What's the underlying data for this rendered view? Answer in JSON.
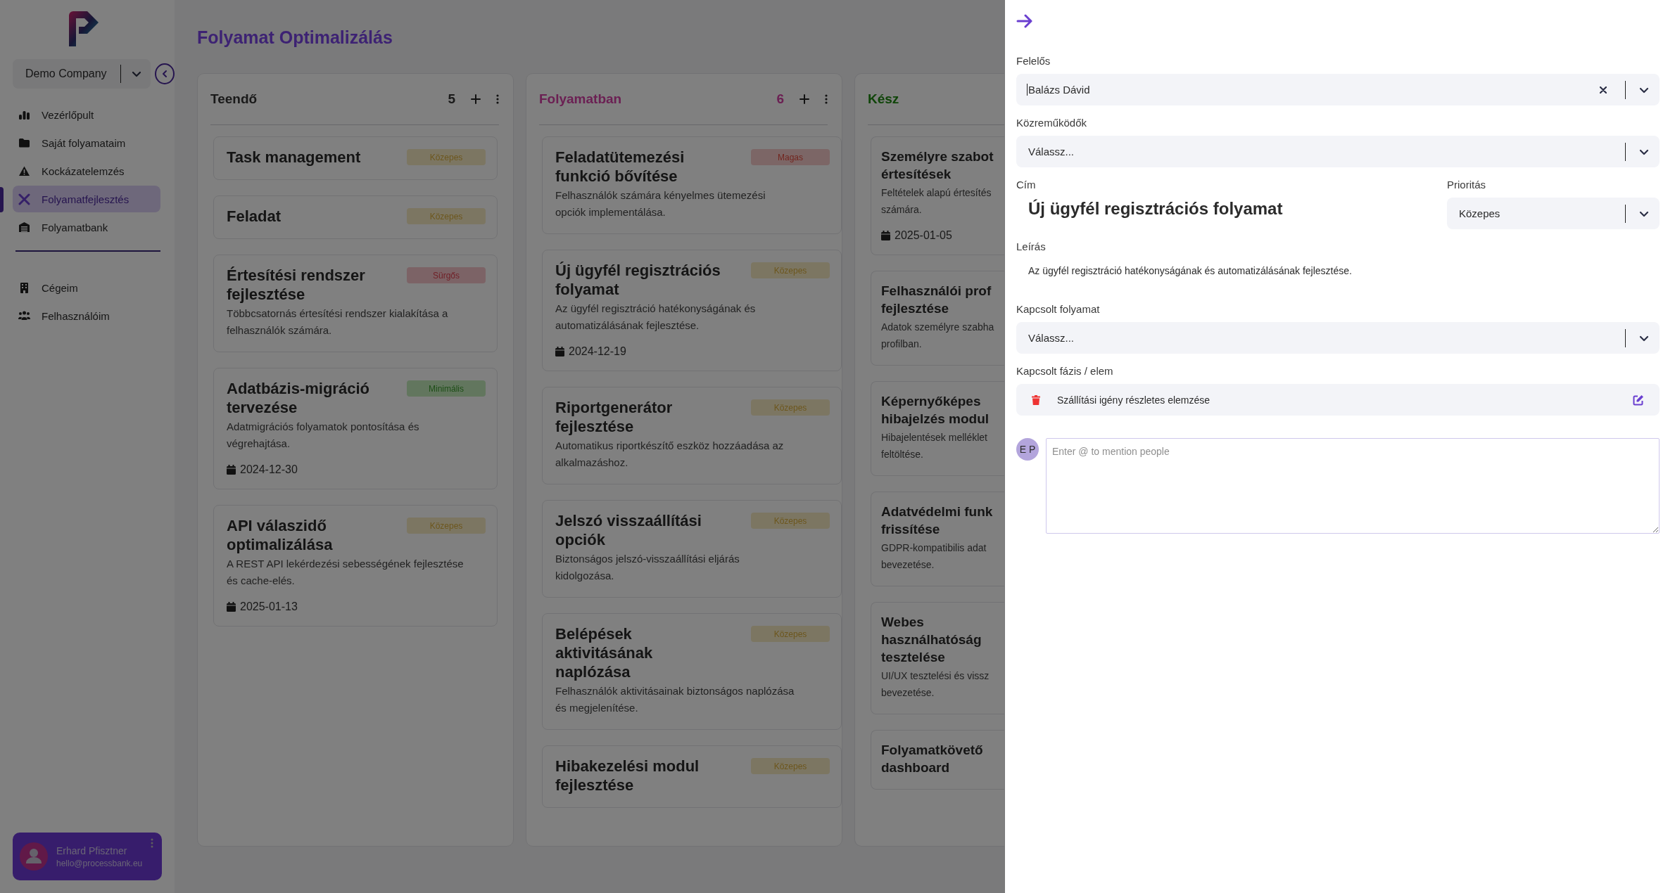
{
  "sidebar": {
    "company": "Demo Company",
    "nav_items": [
      {
        "label": "Vezérlőpult",
        "selected": false
      },
      {
        "label": "Saját folyamataim",
        "selected": false
      },
      {
        "label": "Kockázatelemzés",
        "selected": false
      },
      {
        "label": "Folyamatfejlesztés",
        "selected": true
      },
      {
        "label": "Folyamatbank",
        "selected": false
      }
    ],
    "secondary_items": [
      {
        "label": "Cégeim",
        "selected": false
      },
      {
        "label": "Felhasználóim",
        "selected": false
      }
    ],
    "user": {
      "name": "Erhard Pfisztner",
      "email": "hello@processbank.eu"
    }
  },
  "page_title": "Folyamat Optimalizálás",
  "columns": [
    {
      "title": "Teendő",
      "count": "5",
      "kind": "todo",
      "cards": [
        {
          "title": "Task management",
          "priority": {
            "label": "Közepes",
            "kind": "medium"
          }
        },
        {
          "title": "Feladat",
          "priority": {
            "label": "Közepes",
            "kind": "medium"
          }
        },
        {
          "title": "Értesítési rendszer fejlesztése",
          "description": "Többcsatornás értesítési rendszer kialakítása a felhasználók számára.",
          "priority": {
            "label": "Sürgős",
            "kind": "urgent"
          }
        },
        {
          "title": "Adatbázis-migráció tervezése",
          "description": "Adatmigrációs folyamatok pontosítása és végrehajtása.",
          "date": "2024-12-30",
          "priority": {
            "label": "Minimális",
            "kind": "low"
          }
        },
        {
          "title": "API válaszidő optimalizálása",
          "description": "A REST API lekérdezési sebességének fejlesztése és cache-elés.",
          "date": "2025-01-13",
          "priority": {
            "label": "Közepes",
            "kind": "medium"
          }
        }
      ]
    },
    {
      "title": "Folyamatban",
      "count": "6",
      "kind": "in_progress",
      "cards": [
        {
          "title": "Feladatütemezési funkció bővítése",
          "description": "Felhasználók számára kényelmes ütemezési opciók implementálása.",
          "priority": {
            "label": "Magas",
            "kind": "high"
          }
        },
        {
          "title": "Új ügyfél regisztrációs folyamat",
          "description": "Az ügyfél regisztráció hatékonyságának és automatizálásának fejlesztése.",
          "date": "2024-12-19",
          "priority": {
            "label": "Közepes",
            "kind": "medium"
          }
        },
        {
          "title": "Riportgenerátor fejlesztése",
          "description": "Automatikus riportkészítő eszköz hozzáadása az alkalmazáshoz.",
          "priority": {
            "label": "Közepes",
            "kind": "medium"
          }
        },
        {
          "title": "Jelszó visszaállítási opciók",
          "description": "Biztonságos jelszó-visszaállítási eljárás kidolgozása.",
          "priority": {
            "label": "Közepes",
            "kind": "medium"
          }
        },
        {
          "title": "Belépések aktivitásának naplózása",
          "description": "Felhasználók aktivitásainak biztonságos naplózása és megjelenítése.",
          "priority": {
            "label": "Közepes",
            "kind": "medium"
          }
        },
        {
          "title": "Hibakezelési modul fejlesztése",
          "priority": {
            "label": "Közepes",
            "kind": "medium"
          }
        }
      ]
    },
    {
      "title": "Kész",
      "kind": "done",
      "cards": [
        {
          "title": "Személyre szabot értesítések",
          "description": "Feltételek alapú értesítés számára.",
          "date": "2025-01-05"
        },
        {
          "title": "Felhasználói prof fejlesztése",
          "description": "Adatok személyre szabha profilban."
        },
        {
          "title": "Képernyőképes hibajelzés modul",
          "description": "Hibajelentések melléklet feltöltése."
        },
        {
          "title": "Adatvédelmi funk frissítése",
          "description": "GDPR-kompatibilis adat bevezetése."
        },
        {
          "title": "Webes használhatóság tesztelése",
          "description": "UI/UX tesztelési és vissz bevezetése."
        },
        {
          "title": "Folyamatkövető dashboard"
        }
      ]
    }
  ],
  "panel": {
    "assignee": {
      "label": "Felelős",
      "value": "Balázs Dávid"
    },
    "contributors": {
      "label": "Közreműködők",
      "placeholder": "Válassz..."
    },
    "title": {
      "label": "Cím",
      "value": "Új ügyfél regisztrációs folyamat"
    },
    "priority": {
      "label": "Prioritás",
      "value": "Közepes"
    },
    "description": {
      "label": "Leírás",
      "value": "Az ügyfél regisztráció hatékonyságának és automatizálásának fejlesztése."
    },
    "linked_process": {
      "label": "Kapcsolt folyamat",
      "placeholder": "Válassz..."
    },
    "linked_phase": {
      "label": "Kapcsolt fázis / elem",
      "value": "Szállítási igény részletes elemzése"
    },
    "comment": {
      "avatar": "E P",
      "placeholder": "Enter @ to mention people"
    }
  }
}
